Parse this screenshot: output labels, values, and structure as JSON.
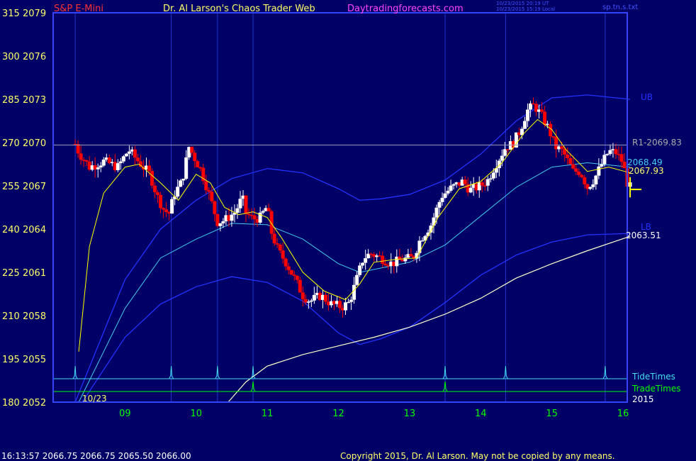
{
  "header": {
    "instrument": "S&P E-Mini",
    "title": "Dr. Al Larson's Chaos Trader Web",
    "site": "Daytradingforecasts.com",
    "timestamp_ut": "10/23/2015 20:19 UT",
    "timestamp_local": "10/23/2015 15:19 Local",
    "file": "sp.tn.s.txt"
  },
  "footer": {
    "quote": "16:13:57  2066.75  2066.75  2065.50  2066.00",
    "copyright": "Copyright 2015, Dr. Al Larson. May not be copied by any means."
  },
  "colors": {
    "background": "#000066",
    "frame": "#3344ff",
    "up_bar": "#ffffff",
    "down_bar": "#ff0000",
    "band_outer": "#2233ff",
    "band_mid": "#44ccee",
    "avg_fast": "#ffff00",
    "avg_slow": "#ffffcc",
    "tide": "#44ddee",
    "trade": "#00ff00"
  },
  "chart_data": {
    "type": "candlestick",
    "y_left_ticks": [
      "315",
      "300",
      "285",
      "270",
      "255",
      "240",
      "225",
      "210",
      "195",
      "180"
    ],
    "y_right_ticks": [
      "2079",
      "2076",
      "2073",
      "2070",
      "2067",
      "2064",
      "2061",
      "2058",
      "2055",
      "2052"
    ],
    "ylim": [
      2052,
      2079
    ],
    "x_ticks": [
      "09",
      "10",
      "11",
      "12",
      "13",
      "14",
      "15",
      "16"
    ],
    "date_label": "10/23",
    "year_label": "2015",
    "levels": [
      {
        "label": "R1-2069.83",
        "value": 2069.83
      },
      {
        "label": "2068.49",
        "value": 2068.49
      },
      {
        "label": "2067.93",
        "value": 2067.93
      },
      {
        "label": "2063.51",
        "value": 2063.51
      }
    ],
    "band_labels": {
      "upper": "UB",
      "lower": "LB"
    },
    "legend": [
      "TideTimes",
      "TradeTimes"
    ],
    "tide_times": [
      8.3,
      9.65,
      10.3,
      10.8,
      13.5,
      14.35,
      15.75
    ],
    "trade_times": [
      10.8,
      13.5
    ],
    "price_path": [
      [
        8.3,
        2069.9
      ],
      [
        8.35,
        2069.3
      ],
      [
        8.5,
        2068.3
      ],
      [
        8.7,
        2068.7
      ],
      [
        8.9,
        2068.3
      ],
      [
        9.05,
        2069.5
      ],
      [
        9.15,
        2068.9
      ],
      [
        9.35,
        2067.8
      ],
      [
        9.45,
        2066.3
      ],
      [
        9.55,
        2065.3
      ],
      [
        9.62,
        2065.1
      ],
      [
        9.7,
        2066.5
      ],
      [
        9.8,
        2067.3
      ],
      [
        9.9,
        2069.7
      ],
      [
        10.0,
        2068.7
      ],
      [
        10.05,
        2068.3
      ],
      [
        10.15,
        2066.9
      ],
      [
        10.25,
        2065.3
      ],
      [
        10.3,
        2064.5
      ],
      [
        10.4,
        2064.6
      ],
      [
        10.55,
        2065.2
      ],
      [
        10.65,
        2066.2
      ],
      [
        10.7,
        2065.1
      ],
      [
        10.8,
        2064.7
      ],
      [
        10.9,
        2064.8
      ],
      [
        11.0,
        2065.6
      ],
      [
        11.05,
        2063.9
      ],
      [
        11.15,
        2062.5
      ],
      [
        11.25,
        2061.8
      ],
      [
        11.4,
        2060.4
      ],
      [
        11.5,
        2059.4
      ],
      [
        11.6,
        2059.0
      ],
      [
        11.75,
        2059.4
      ],
      [
        11.9,
        2058.8
      ],
      [
        12.05,
        2058.6
      ],
      [
        12.15,
        2058.9
      ],
      [
        12.25,
        2060.4
      ],
      [
        12.35,
        2062.0
      ],
      [
        12.45,
        2062.3
      ],
      [
        12.6,
        2062.0
      ],
      [
        12.75,
        2061.6
      ],
      [
        12.9,
        2061.9
      ],
      [
        13.05,
        2062.0
      ],
      [
        13.15,
        2063.3
      ],
      [
        13.3,
        2064.3
      ],
      [
        13.45,
        2066.3
      ],
      [
        13.6,
        2066.9
      ],
      [
        13.75,
        2067.3
      ],
      [
        13.85,
        2066.7
      ],
      [
        14.0,
        2067.0
      ],
      [
        14.1,
        2067.4
      ],
      [
        14.2,
        2068.4
      ],
      [
        14.35,
        2069.7
      ],
      [
        14.45,
        2069.9
      ],
      [
        14.55,
        2070.8
      ],
      [
        14.65,
        2072.2
      ],
      [
        14.75,
        2072.6
      ],
      [
        14.85,
        2071.9
      ],
      [
        14.95,
        2071.0
      ],
      [
        15.05,
        2069.7
      ],
      [
        15.15,
        2069.4
      ],
      [
        15.3,
        2068.0
      ],
      [
        15.4,
        2068.0
      ],
      [
        15.5,
        2066.9
      ],
      [
        15.6,
        2067.5
      ],
      [
        15.7,
        2068.5
      ],
      [
        15.8,
        2069.4
      ],
      [
        15.9,
        2069.3
      ],
      [
        16.0,
        2068.6
      ],
      [
        16.05,
        2067.3
      ],
      [
        16.1,
        2066.9
      ]
    ],
    "upper_band": [
      [
        8.3,
        2052
      ],
      [
        9.0,
        2060.5
      ],
      [
        9.5,
        2064.0
      ],
      [
        10.0,
        2066.0
      ],
      [
        10.5,
        2067.5
      ],
      [
        11.0,
        2068.2
      ],
      [
        11.5,
        2067.9
      ],
      [
        12.0,
        2066.8
      ],
      [
        12.3,
        2066.0
      ],
      [
        12.6,
        2066.1
      ],
      [
        13.0,
        2066.4
      ],
      [
        13.5,
        2067.4
      ],
      [
        14.0,
        2069.2
      ],
      [
        14.5,
        2071.5
      ],
      [
        15.0,
        2073.1
      ],
      [
        15.5,
        2073.3
      ],
      [
        16.1,
        2073.0
      ]
    ],
    "mid_band": [
      [
        8.35,
        2052
      ],
      [
        9.0,
        2058.5
      ],
      [
        9.5,
        2062.0
      ],
      [
        10.0,
        2063.3
      ],
      [
        10.5,
        2064.4
      ],
      [
        11.0,
        2064.3
      ],
      [
        11.5,
        2063.3
      ],
      [
        12.0,
        2061.6
      ],
      [
        12.3,
        2061.0
      ],
      [
        12.6,
        2061.3
      ],
      [
        13.0,
        2061.7
      ],
      [
        13.5,
        2062.9
      ],
      [
        14.0,
        2064.9
      ],
      [
        14.5,
        2066.9
      ],
      [
        15.0,
        2068.3
      ],
      [
        15.5,
        2068.6
      ],
      [
        16.1,
        2068.3
      ]
    ],
    "lower_band": [
      [
        8.4,
        2052
      ],
      [
        9.0,
        2056.5
      ],
      [
        9.5,
        2058.8
      ],
      [
        10.0,
        2060.0
      ],
      [
        10.5,
        2060.7
      ],
      [
        11.0,
        2060.3
      ],
      [
        11.5,
        2059.0
      ],
      [
        12.0,
        2056.8
      ],
      [
        12.3,
        2056.0
      ],
      [
        12.6,
        2056.4
      ],
      [
        13.0,
        2057.2
      ],
      [
        13.5,
        2058.9
      ],
      [
        14.0,
        2060.8
      ],
      [
        14.5,
        2062.2
      ],
      [
        15.0,
        2063.1
      ],
      [
        15.5,
        2063.6
      ],
      [
        16.1,
        2063.7
      ]
    ],
    "slow_average": [
      [
        10.45,
        2052
      ],
      [
        10.7,
        2053.4
      ],
      [
        11.0,
        2054.5
      ],
      [
        11.5,
        2055.3
      ],
      [
        12.0,
        2055.9
      ],
      [
        12.5,
        2056.5
      ],
      [
        13.0,
        2057.2
      ],
      [
        13.5,
        2058.1
      ],
      [
        14.0,
        2059.2
      ],
      [
        14.5,
        2060.6
      ],
      [
        15.0,
        2061.6
      ],
      [
        15.5,
        2062.5
      ],
      [
        16.1,
        2063.5
      ]
    ],
    "fast_average": [
      [
        8.35,
        2055.5
      ],
      [
        8.5,
        2062.8
      ],
      [
        8.7,
        2066.5
      ],
      [
        9.0,
        2068.3
      ],
      [
        9.2,
        2068.5
      ],
      [
        9.5,
        2067.2
      ],
      [
        9.75,
        2066.0
      ],
      [
        10.0,
        2067.8
      ],
      [
        10.2,
        2067.2
      ],
      [
        10.4,
        2065.5
      ],
      [
        10.6,
        2065.0
      ],
      [
        10.8,
        2065.2
      ],
      [
        11.0,
        2064.8
      ],
      [
        11.2,
        2063.4
      ],
      [
        11.5,
        2061.0
      ],
      [
        11.8,
        2059.7
      ],
      [
        12.1,
        2059.1
      ],
      [
        12.3,
        2060.2
      ],
      [
        12.5,
        2061.7
      ],
      [
        12.8,
        2061.9
      ],
      [
        13.1,
        2062.0
      ],
      [
        13.4,
        2064.8
      ],
      [
        13.7,
        2066.8
      ],
      [
        14.0,
        2067.3
      ],
      [
        14.3,
        2068.6
      ],
      [
        14.6,
        2070.6
      ],
      [
        14.8,
        2071.6
      ],
      [
        15.0,
        2070.9
      ],
      [
        15.2,
        2069.5
      ],
      [
        15.5,
        2068.0
      ],
      [
        15.8,
        2068.3
      ],
      [
        16.1,
        2067.9
      ]
    ]
  }
}
